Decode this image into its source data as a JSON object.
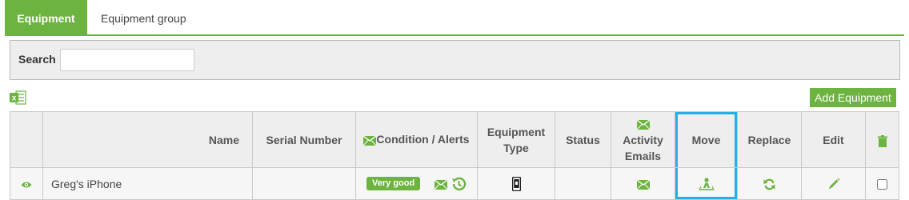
{
  "tabs": [
    {
      "label": "Equipment",
      "active": true
    },
    {
      "label": "Equipment group",
      "active": false
    }
  ],
  "search": {
    "label": "Search",
    "value": "",
    "placeholder": ""
  },
  "toolbar": {
    "add_label": "Add Equipment",
    "export_icon": "excel-icon"
  },
  "table": {
    "headers": {
      "name": "Name",
      "serial": "Serial Number",
      "condition": "Condition / Alerts",
      "type": "Equipment Type",
      "status": "Status",
      "activity": "Activity Emails",
      "move": "Move",
      "replace": "Replace",
      "edit": "Edit"
    },
    "rows": [
      {
        "name": "Greg's iPhone",
        "serial": "",
        "condition": "Very good",
        "status": ""
      }
    ]
  },
  "colors": {
    "accent": "#6cb33f",
    "highlight": "#29aee0",
    "panel": "#eeeeee"
  }
}
